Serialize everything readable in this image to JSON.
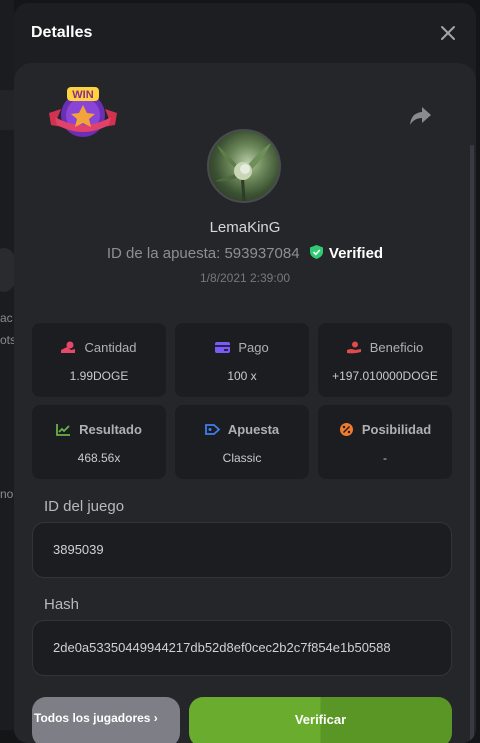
{
  "background": {
    "frag1": "ac",
    "frag2": "ots",
    "frag3": "no"
  },
  "modal": {
    "title": "Detalles",
    "username": "LemaKinG",
    "bet_id_label": "ID de la apuesta:",
    "bet_id_value": "593937084",
    "verified_label": "Verified",
    "date": "1/8/2021 2:39:00",
    "badge_text": "WIN"
  },
  "stats": [
    {
      "label": "Cantidad",
      "value": "1.99DOGE",
      "icon": "coins-icon",
      "color": "#e8476a"
    },
    {
      "label": "Pago",
      "value": "100 x",
      "icon": "card-icon",
      "color": "#7b5cf0"
    },
    {
      "label": "Beneficio",
      "value": "+197.010000DOGE",
      "icon": "hand-coin-icon",
      "color": "#e04b4b"
    },
    {
      "label": "Resultado",
      "value": "468.56x",
      "icon": "chart-icon",
      "color": "#6ab04c"
    },
    {
      "label": "Apuesta",
      "value": "Classic",
      "icon": "tag-icon",
      "color": "#3f7ff0"
    },
    {
      "label": "Posibilidad",
      "value": "-",
      "icon": "percent-icon",
      "color": "#f07a2e"
    }
  ],
  "fields": {
    "game_id_label": "ID del juego",
    "game_id_value": "3895039",
    "hash_label": "Hash",
    "hash_value": "2de0a53350449944217db52d8ef0cec2b2c7f854e1b50588"
  },
  "buttons": {
    "all_players": "Todos los jugadores ›",
    "verify": "Verificar"
  },
  "colors": {
    "accent_green": "#6aad2e",
    "verified_green": "#2ecc71"
  }
}
